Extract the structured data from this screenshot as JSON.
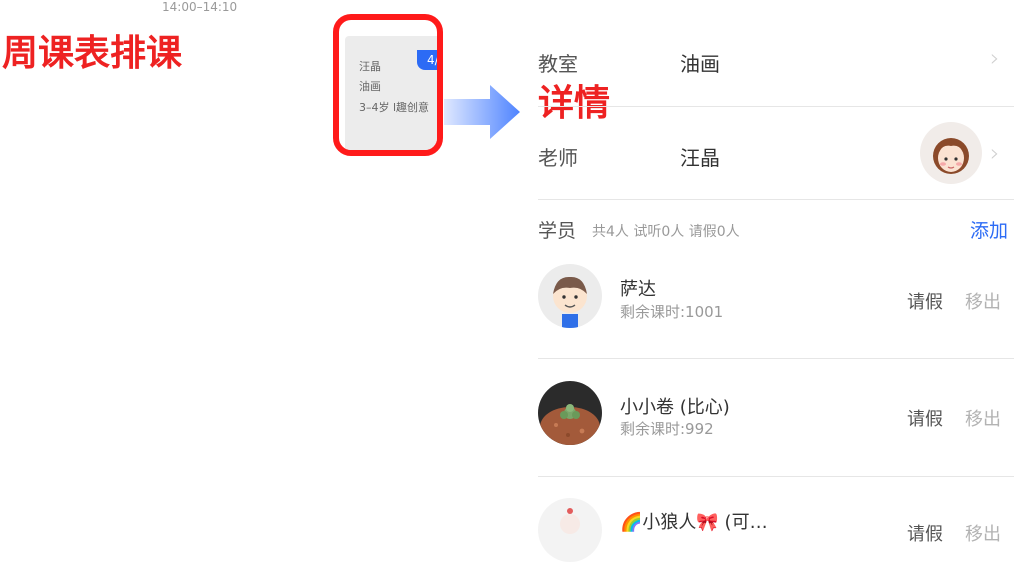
{
  "left": {
    "time_range": "14:00–14:10",
    "title": "周课表排课",
    "card": {
      "badge": "4/",
      "lines": [
        "汪晶",
        "油画",
        "3–4岁 l趣创意"
      ]
    }
  },
  "detail": {
    "annotation": "详情",
    "classroom": {
      "label": "教室",
      "value": "油画"
    },
    "teacher": {
      "label": "老师",
      "value": "汪晶"
    },
    "students_header": {
      "label": "学员",
      "summary": "共4人 试听0人 请假0人",
      "add": "添加"
    },
    "students": [
      {
        "name": "萨达",
        "remaining": "剩余课时:1001",
        "leave": "请假",
        "remove": "移出"
      },
      {
        "name": "小小卷 (比心)",
        "remaining": "剩余课时:992",
        "leave": "请假",
        "remove": "移出"
      },
      {
        "name": "🌈小狼人🎀 (可…",
        "remaining": "",
        "leave": "请假",
        "remove": "移出"
      }
    ]
  },
  "colors": {
    "accent_blue": "#2c6bf5",
    "annotation_red": "#ee2222",
    "highlight_border": "#ff1a1a"
  }
}
